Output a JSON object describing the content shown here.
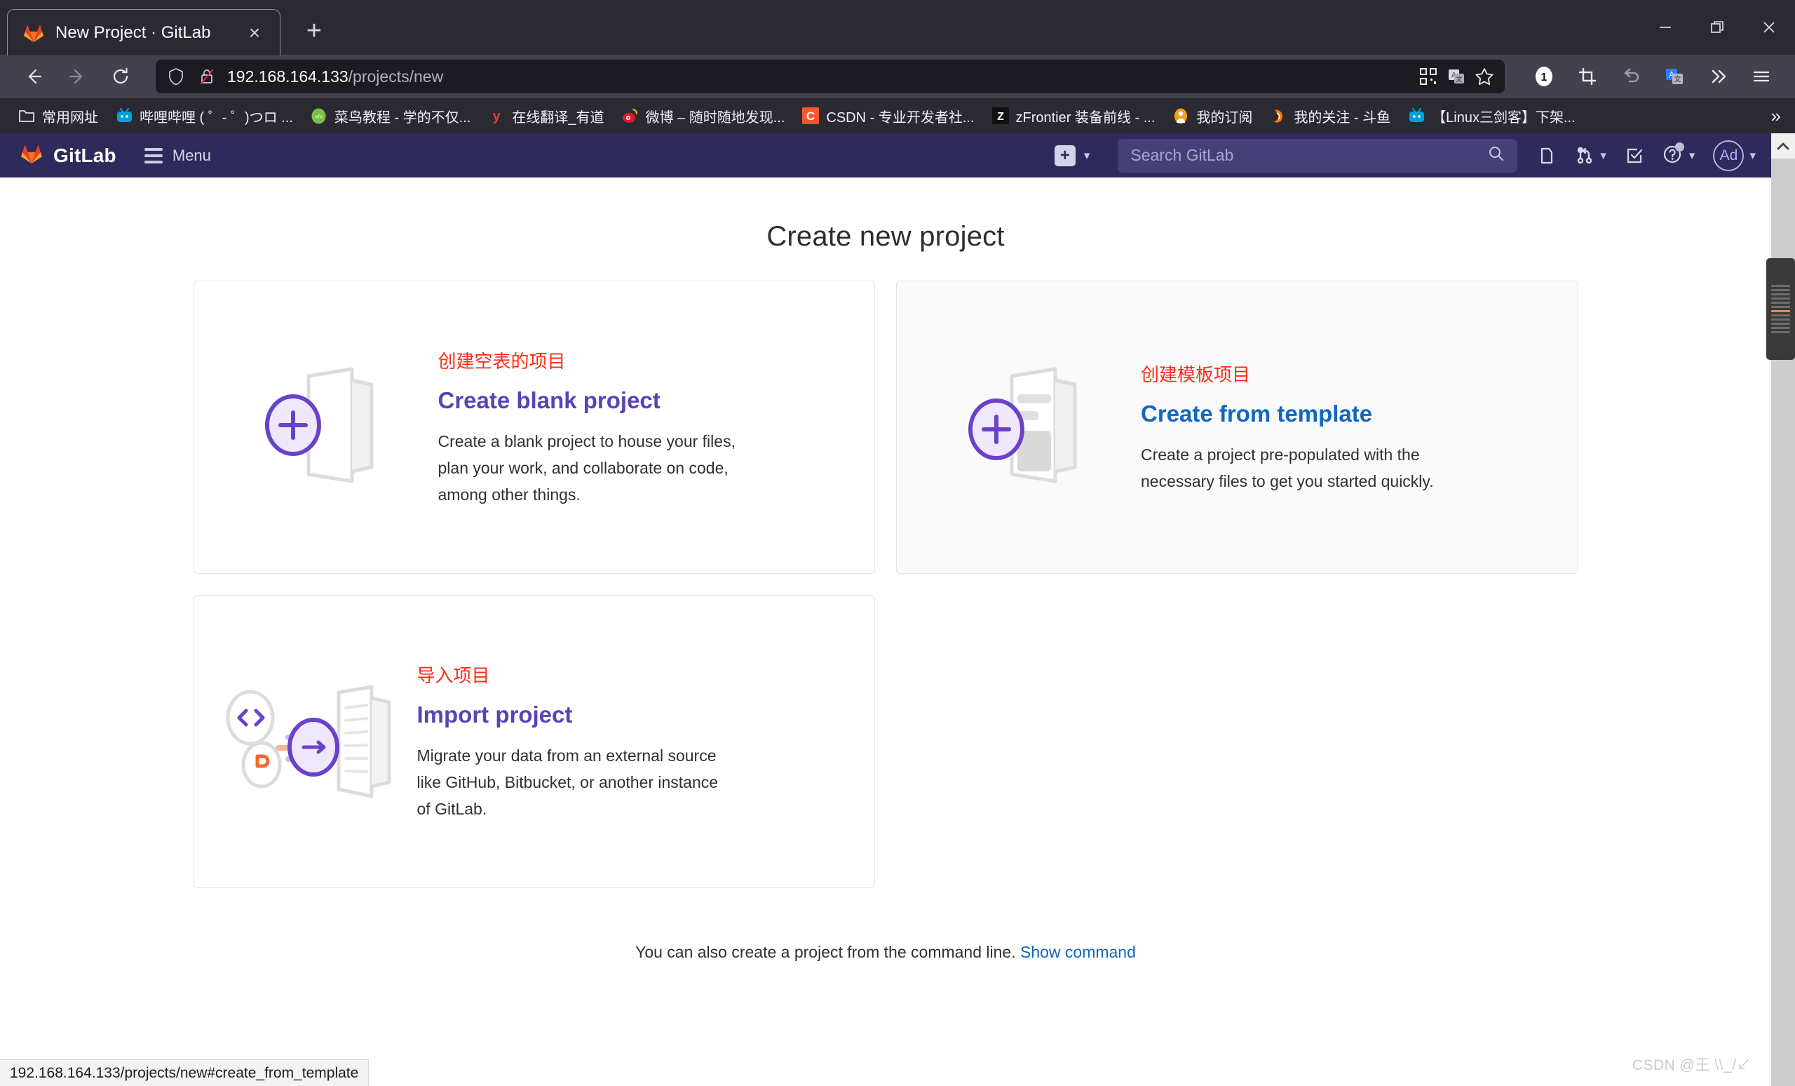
{
  "browser": {
    "tab": {
      "title": "New Project · GitLab",
      "favicon": "gitlab-fox-icon",
      "close_label": "×"
    },
    "new_tab_label": "+",
    "window_controls": {
      "minimize": "minimize-icon",
      "maximize": "maximize-icon",
      "close": "close-icon"
    },
    "nav": {
      "back": "back-arrow-icon",
      "forward": "forward-arrow-icon",
      "reload": "reload-icon",
      "shield": "shield-icon",
      "lock": "lock-insecure-icon",
      "url_host": "192.168.164.133",
      "url_path": "/projects/new",
      "qr_icon": "qr-code-icon",
      "translate_icon": "translate-icon",
      "bookmark_icon": "star-icon",
      "ext_badge": "1",
      "ext_crop": "crop-screenshot-icon",
      "ext_undo": "undo-arrow-icon",
      "ext_translate": "translate-extension-icon",
      "overflow": "chevron-double-right-icon",
      "menu": "hamburger-menu-icon"
    },
    "bookmarks": [
      {
        "label": "常用网址",
        "icon": "folder-icon"
      },
      {
        "label": "哔哩哔哩 ( ゜- ゜)つロ ...",
        "icon": "bilibili-icon"
      },
      {
        "label": "菜鸟教程 - 学的不仅...",
        "icon": "runoob-icon"
      },
      {
        "label": "在线翻译_有道",
        "icon": "youdao-icon"
      },
      {
        "label": "微博 – 随时随地发现...",
        "icon": "weibo-icon"
      },
      {
        "label": "CSDN - 专业开发者社...",
        "icon": "csdn-icon"
      },
      {
        "label": "zFrontier 装备前线 - ...",
        "icon": "zfrontier-icon"
      },
      {
        "label": "我的订阅",
        "icon": "subscription-icon"
      },
      {
        "label": "我的关注 - 斗鱼",
        "icon": "douyu-icon"
      },
      {
        "label": "【Linux三剑客】下架...",
        "icon": "bilibili-icon"
      }
    ],
    "bookmarks_overflow": "»",
    "status_link": "192.168.164.133/projects/new#create_from_template"
  },
  "gitlab": {
    "brand": "GitLab",
    "menu_label": "Menu",
    "create_new_label": "+",
    "search_placeholder": "Search GitLab",
    "icons": {
      "search": "search-icon",
      "issues": "issues-icon",
      "merge_requests": "merge-request-icon",
      "todos": "todo-checkbox-icon",
      "help": "help-question-icon"
    },
    "avatar_initials": "Ad"
  },
  "main": {
    "title": "Create new project",
    "cards": [
      {
        "zh_label": "创建空表的项目",
        "title": "Create blank project",
        "desc": "Create a blank project to house your files, plan your work, and collaborate on code, among other things.",
        "icon": "blank-project-icon",
        "hovered": false
      },
      {
        "zh_label": "创建模板项目",
        "title": "Create from template",
        "desc": "Create a project pre-populated with the necessary files to get you started quickly.",
        "icon": "template-project-icon",
        "hovered": true
      },
      {
        "zh_label": "导入项目",
        "title": "Import project",
        "desc": "Migrate your data from an external source like GitHub, Bitbucket, or another instance of GitLab.",
        "icon": "import-project-icon",
        "hovered": false
      }
    ],
    "footer_text": "You can also create a project from the command line.",
    "footer_link": "Show command"
  },
  "watermark": "CSDN @王 \\\\_/↙",
  "colors": {
    "gitlab_nav": "#2e2a5b",
    "accent_purple": "#5943b6",
    "accent_blue": "#1068bf",
    "zh_red": "#ff2b16",
    "chrome_dark": "#2b2a33"
  }
}
